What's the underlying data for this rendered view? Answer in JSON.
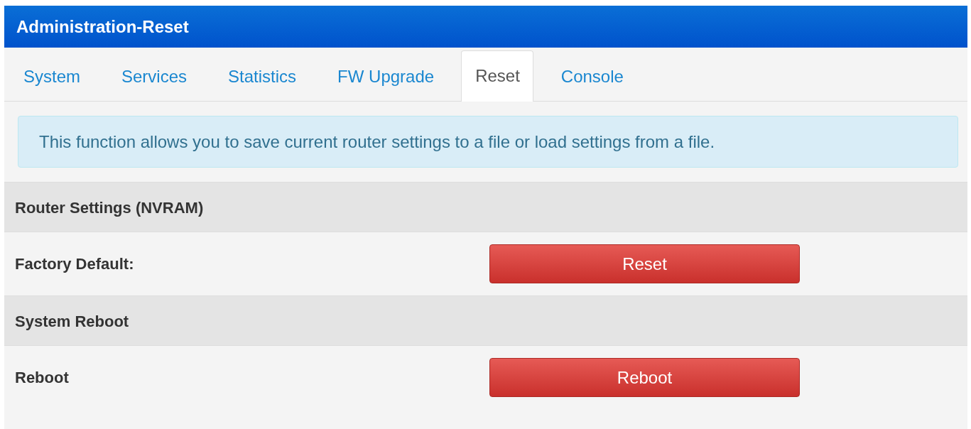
{
  "header": {
    "title": "Administration-Reset"
  },
  "tabs": [
    {
      "label": "System",
      "selected": false
    },
    {
      "label": "Services",
      "selected": false
    },
    {
      "label": "Statistics",
      "selected": false
    },
    {
      "label": "FW Upgrade",
      "selected": false
    },
    {
      "label": "Reset",
      "selected": true
    },
    {
      "label": "Console",
      "selected": false
    }
  ],
  "info": "This function allows you to save current router settings to a file or load settings from a file.",
  "sections": [
    {
      "title": "Router Settings (NVRAM)",
      "rows": [
        {
          "label": "Factory Default:",
          "button": "Reset"
        }
      ]
    },
    {
      "title": "System Reboot",
      "rows": [
        {
          "label": "Reboot",
          "button": "Reboot"
        }
      ]
    }
  ]
}
